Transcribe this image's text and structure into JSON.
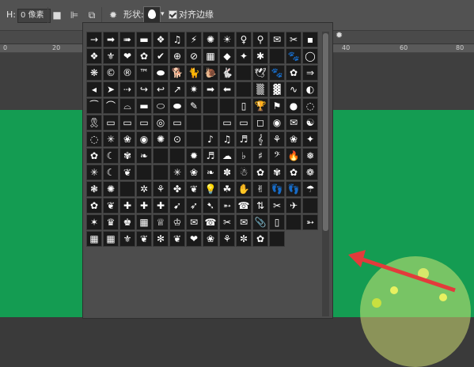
{
  "options_bar": {
    "h_label": "H:",
    "h_value": "0 像素",
    "shape_label": "形状:",
    "align_edges_label": "对齐边缘",
    "icons": [
      "rect-icon",
      "align-icon",
      "arrange-icon",
      "gear-icon"
    ]
  },
  "ruler": {
    "ticks": [
      "0",
      "20",
      "40",
      "60",
      "80"
    ]
  },
  "shapes_panel": {
    "shape_glyphs": [
      "→",
      "➡",
      "➠",
      "▬",
      "❖",
      "♫",
      "⚡",
      "✺",
      "☀",
      "♀",
      "⚲",
      "✉",
      "✂",
      "▪",
      "❖",
      "⚜",
      "❤",
      "✿",
      "✔",
      "⊕",
      "⊘",
      "▦",
      "◆",
      "✦",
      "✱",
      "",
      "🐾",
      "◯",
      "❋",
      "©",
      "®",
      "™",
      "⬬",
      "🐕",
      "🐈",
      "🐌",
      "🐇",
      "",
      "🕊",
      "🐾",
      "✿",
      "⇒",
      "◂",
      "➤",
      "⇢",
      "↪",
      "↩",
      "↗",
      "✷",
      "➡",
      "⬅",
      "",
      "▒",
      "▓",
      "∿",
      "◐",
      "⁀",
      "⌒",
      "⌓",
      "▬",
      "⬭",
      "⬬",
      "✎",
      "",
      "",
      "▯",
      "🏆",
      "⚑",
      "●",
      "◌",
      "🎗",
      "▭",
      "▭",
      "▭",
      "◎",
      "▭",
      "",
      "",
      "▭",
      "▭",
      "◻",
      "◉",
      "✉",
      "☯",
      "◌",
      "✳",
      "❀",
      "◉",
      "✺",
      "⊙",
      "",
      "♪",
      "♫",
      "♬",
      "𝄞",
      "⚘",
      "❀",
      "✦",
      "✿",
      "☾",
      "✾",
      "❧",
      "",
      "",
      "✹",
      "♬",
      "☁",
      "♭",
      "♯",
      "𝄢",
      "🔥",
      "❅",
      "✳",
      "☾",
      "❦",
      "",
      "",
      "✳",
      "❀",
      "❧",
      "✽",
      "☃",
      "✿",
      "✾",
      "✿",
      "❁",
      "❃",
      "✺",
      "",
      "✲",
      "⚘",
      "✤",
      "❦",
      "💡",
      "☘",
      "✋",
      "✌",
      "👣",
      "👣",
      "☂",
      "✿",
      "❦",
      "✚",
      "✚",
      "✚",
      "➹",
      "➶",
      "➷",
      "➵",
      "☎",
      "⇅",
      "✂",
      "✈",
      "",
      "✶",
      "♛",
      "♚",
      "▦",
      "♕",
      "♔",
      "✉",
      "☎",
      "✂",
      "✉",
      "📎",
      "▯",
      "",
      "➳",
      "▦",
      "▦",
      "⚜",
      "❦",
      "✻",
      "❦",
      "❤",
      "❀",
      "⚘",
      "✼",
      "✿",
      ""
    ]
  }
}
